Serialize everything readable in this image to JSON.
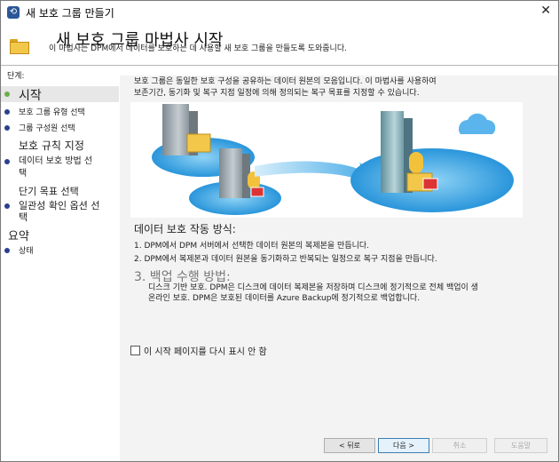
{
  "window": {
    "title": "새 보호 그룹 만들기",
    "header_title": "새 보호 그룹 마법사 시작",
    "header_subtitle": "이 마법사는 DPM에서 데이터를 보호하는 데 사용할 새 보호 그룹을 만들도록 도와줍니다."
  },
  "sidebar": {
    "label": "단계:",
    "steps": [
      "시작",
      "보호 그룹 유형 선택",
      "그룹 구성원 선택",
      "보호 규칙 지정",
      "데이터 보호 방법 선택",
      "단기 목표 선택",
      "일관성 확인 옵션 선택",
      "요약",
      "상태"
    ]
  },
  "content": {
    "intro_line1": "보호 그룹은 동일한 보호 구성을 공유하는 데이터 원본의 모음입니다. 이 마법사를 사용하여",
    "intro_line2": "보존기간, 동기화 및 복구 지점 일정에 의해 정의되는 복구 목표를 지정할 수 있습니다.",
    "how_title": "데이터 보호 작동 방식:",
    "how_items": [
      "1. DPM에서 DPM 서버에서 선택한 데이터 원본의 복제본을 만듭니다.",
      "2. DPM에서 복제본과 데이터 원본을 동기화하고 반복되는 일정으로 복구 지점을 만듭니다."
    ],
    "backup_title": "3. 백업 수행 방법:",
    "backup_lines": [
      "디스크 기반 보호. DPM은 디스크에 데이터 복제본을 저장하며 디스크에 정기적으로 전체 백업이 생",
      "온라인 보호. DPM은 보호된 데이터를 Azure Backup에 정기적으로 백업합니다."
    ],
    "checkbox_label": "이 시작 페이지를 다시 표시 안 함"
  },
  "buttons": {
    "back": "< 뒤로",
    "next": "다음 >",
    "cancel": "취소",
    "help": "도움말"
  },
  "colors": {
    "accent": "#2b3f8f",
    "active_step": "#6ab04c",
    "content_bg": "#f3f3f3"
  }
}
